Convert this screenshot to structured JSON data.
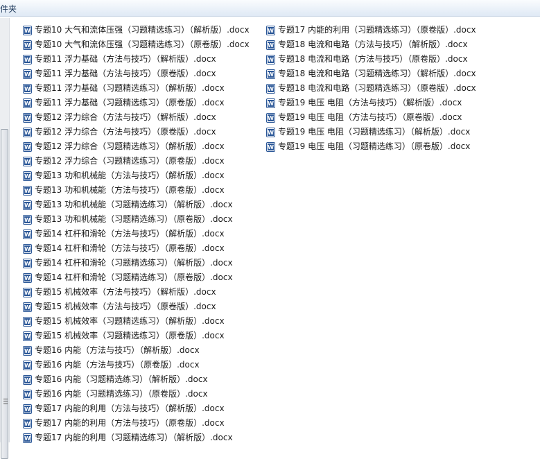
{
  "header": {
    "title": "件夹"
  },
  "icons": {
    "file": "word-doc-icon",
    "accent": "#2b5797"
  },
  "files_col1": [
    "专题10 大气和流体压强（习题精选练习）（解析版）.docx",
    "专题10 大气和流体压强（习题精选练习）（原卷版）.docx",
    "专题11 浮力基础（方法与技巧）（解析版）.docx",
    "专题11 浮力基础（方法与技巧）（原卷版）.docx",
    "专题11 浮力基础（习题精选练习）（解析版）.docx",
    "专题11 浮力基础（习题精选练习）（原卷版）.docx",
    "专题12 浮力综合（方法与技巧）（解析版）.docx",
    "专题12 浮力综合（方法与技巧）（原卷版）.docx",
    "专题12 浮力综合（习题精选练习）（解析版）.docx",
    "专题12 浮力综合（习题精选练习）（原卷版）.docx",
    "专题13 功和机械能（方法与技巧）（解析版）.docx",
    "专题13 功和机械能（方法与技巧）（原卷版）.docx",
    "专题13 功和机械能（习题精选练习）（解析版）.docx",
    "专题13 功和机械能（习题精选练习）（原卷版）.docx",
    "专题14 杠杆和滑轮（方法与技巧）（解析版）.docx",
    "专题14 杠杆和滑轮（方法与技巧）（原卷版）.docx",
    "专题14 杠杆和滑轮（习题精选练习）（解析版）.docx",
    "专题14 杠杆和滑轮（习题精选练习）（原卷版）.docx",
    "专题15 机械效率（方法与技巧）（解析版）.docx",
    "专题15 机械效率（方法与技巧）（原卷版）.docx",
    "专题15 机械效率（习题精选练习）（解析版）.docx",
    "专题15 机械效率（习题精选练习）（原卷版）.docx",
    "专题16 内能（方法与技巧）（解析版）.docx",
    "专题16 内能（方法与技巧）（原卷版）.docx",
    "专题16 内能（习题精选练习）（解析版）.docx",
    "专题16 内能（习题精选练习）（原卷版）.docx",
    "专题17 内能的利用（方法与技巧）（解析版）.docx",
    "专题17 内能的利用（方法与技巧）（原卷版）.docx",
    "专题17 内能的利用（习题精选练习）（解析版）.docx"
  ],
  "files_col2": [
    "专题17 内能的利用（习题精选练习）（原卷版）.docx",
    "专题18 电流和电路（方法与技巧）（解析版）.docx",
    "专题18 电流和电路（方法与技巧）（原卷版）.docx",
    "专题18 电流和电路（习题精选练习）（解析版）.docx",
    "专题18 电流和电路（习题精选练习）（原卷版）.docx",
    "专题19 电压 电阻（方法与技巧）（解析版）.docx",
    "专题19 电压 电阻（方法与技巧）（原卷版）.docx",
    "专题19 电压 电阻（习题精选练习）（解析版）.docx",
    "专题19 电压 电阻（习题精选练习）（原卷版）.docx"
  ]
}
